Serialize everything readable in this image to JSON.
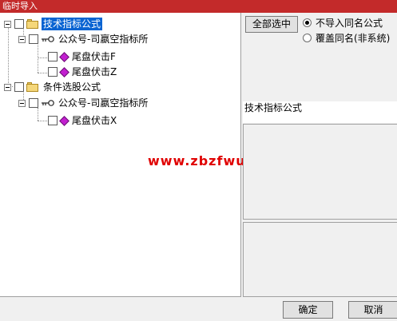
{
  "window": {
    "title": "临时导入"
  },
  "tree": {
    "group1": {
      "label": "技术指标公式"
    },
    "group1_author": {
      "label": "公众号-司嬴空指标所"
    },
    "group1_items": [
      "尾盘伏击F",
      "尾盘伏击Z"
    ],
    "group2": {
      "label": "条件选股公式"
    },
    "group2_author": {
      "label": "公众号-司嬴空指标所"
    },
    "group2_items": [
      "尾盘伏击X"
    ]
  },
  "watermark": "www.zbzfwu.com",
  "options": {
    "select_all_label": "全部选中",
    "radio_skip_label": "不导入同名公式",
    "radio_overwrite_label": "覆盖同名(非系统)",
    "selected": "radio_skip"
  },
  "detail": {
    "name": "技术指标公式"
  },
  "footer": {
    "ok_label": "确定",
    "cancel_label": "取消"
  },
  "colors": {
    "title_bar": "#c32a2a",
    "selection": "#0a64d2",
    "watermark": "#e00000",
    "item_icon": "#c21fd0"
  }
}
